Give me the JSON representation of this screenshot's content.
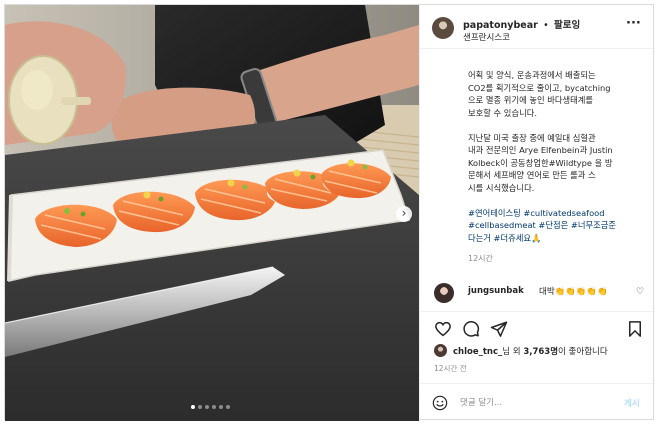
{
  "post": {
    "username": "papatonybear",
    "separator": "•",
    "follow_label": "팔로잉",
    "location": "샌프란시스코",
    "more_label": "···",
    "caption": {
      "p1": "어획 및 양식, 운송과정에서 배출되는\nCO2를 획기적으로 줄이고, bycatching\n으로 멸종 위기에 놓인 바다생태계를\n보호할 수 있습니다.",
      "p2": "지난달 미국 출장 중에 예일대 심혈관\n내과 전문의인 Arye Elfenbein과 Justin\nKolbeck이 공동창업한#Wildtype 을 방\n문해서 세프배양 연어로 만든 롤과 스\n시를 시식했습니다.",
      "p3": "#연어테이스팅 #cultivatedseafood\n#cellbasedmeat #단점은 #너무조금준\n다는거 #더쥬세요🙏"
    },
    "time_ago": "12시간",
    "comment": {
      "user": "jungsunbak",
      "text": "대박👏👏👏👏👏"
    },
    "likes": {
      "user": "chloe_tnc_",
      "middle": "님 외 ",
      "count": "3,763명",
      "suffix": "이 좋아합니다"
    },
    "timestamp": "12시간 전",
    "compose": {
      "placeholder": "댓글 달기...",
      "post_label": "게시"
    }
  },
  "carousel": {
    "total_slides": 6,
    "active_slide": 1,
    "next_label": "›"
  },
  "icons": [
    "heart-icon",
    "comment-icon",
    "share-icon",
    "bookmark-icon",
    "emoji-icon",
    "more-icon"
  ],
  "colors": {
    "text": "#262626",
    "muted": "#8e8e8e",
    "hashtag": "#00376b",
    "post_button_disabled": "#b2dffc",
    "divider": "#efefef"
  }
}
